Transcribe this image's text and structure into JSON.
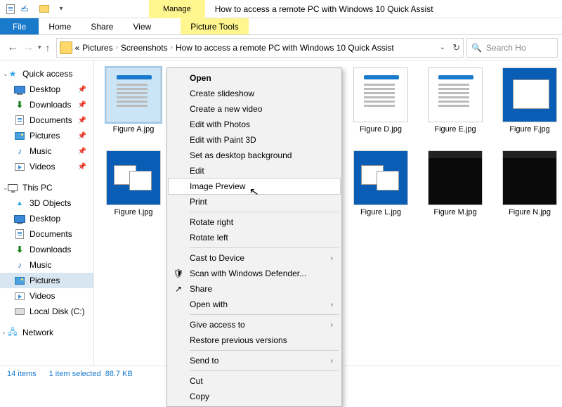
{
  "titlebar": {
    "manage_tab": "Manage",
    "tools_tab": "Picture Tools",
    "window_title": "How to access a remote PC with Windows 10 Quick Assist"
  },
  "ribbon": {
    "file": "File",
    "home": "Home",
    "share": "Share",
    "view": "View",
    "picture_tools": "Picture Tools"
  },
  "address": {
    "chevrons": "«",
    "crumbs": [
      "Pictures",
      "Screenshots",
      "How to access a remote PC with Windows 10 Quick Assist"
    ]
  },
  "search": {
    "placeholder": "Search Ho"
  },
  "sidebar": {
    "quick_access": "Quick access",
    "qa_items": [
      {
        "label": "Desktop",
        "icon": "desktop"
      },
      {
        "label": "Downloads",
        "icon": "downloads"
      },
      {
        "label": "Documents",
        "icon": "documents"
      },
      {
        "label": "Pictures",
        "icon": "pictures"
      },
      {
        "label": "Music",
        "icon": "music"
      },
      {
        "label": "Videos",
        "icon": "videos"
      }
    ],
    "this_pc": "This PC",
    "pc_items": [
      {
        "label": "3D Objects",
        "icon": "3d"
      },
      {
        "label": "Desktop",
        "icon": "desktop"
      },
      {
        "label": "Documents",
        "icon": "documents"
      },
      {
        "label": "Downloads",
        "icon": "downloads"
      },
      {
        "label": "Music",
        "icon": "music"
      },
      {
        "label": "Pictures",
        "icon": "pictures",
        "selected": true
      },
      {
        "label": "Videos",
        "icon": "videos"
      },
      {
        "label": "Local Disk (C:)",
        "icon": "disk"
      }
    ],
    "network": "Network"
  },
  "files_row1": [
    {
      "label": "Figure A.jpg",
      "thumb": "white",
      "selected": true
    },
    {
      "label": "Figure D.jpg",
      "thumb": "white"
    },
    {
      "label": "Figure E.jpg",
      "thumb": "white"
    },
    {
      "label": "Figure F.jpg",
      "thumb": "desk"
    }
  ],
  "files_row2": [
    {
      "label": "Figure I.jpg",
      "thumb": "desk2"
    },
    {
      "label": "Figure L.jpg",
      "thumb": "desk2"
    },
    {
      "label": "Figure M.jpg",
      "thumb": "black"
    },
    {
      "label": "Figure N.jpg",
      "thumb": "black"
    }
  ],
  "context_menu": [
    {
      "label": "Open",
      "bold": true
    },
    {
      "label": "Create slideshow"
    },
    {
      "label": "Create a new video"
    },
    {
      "label": "Edit with Photos"
    },
    {
      "label": "Edit with Paint 3D"
    },
    {
      "label": "Set as desktop background"
    },
    {
      "label": "Edit"
    },
    {
      "label": "Image Preview",
      "hover": true
    },
    {
      "label": "Print"
    },
    {
      "sep": true
    },
    {
      "label": "Rotate right"
    },
    {
      "label": "Rotate left"
    },
    {
      "sep": true
    },
    {
      "label": "Cast to Device",
      "submenu": true
    },
    {
      "label": "Scan with Windows Defender...",
      "icon": "shield"
    },
    {
      "label": "Share",
      "icon": "share"
    },
    {
      "label": "Open with",
      "submenu": true
    },
    {
      "sep": true
    },
    {
      "label": "Give access to",
      "submenu": true
    },
    {
      "label": "Restore previous versions"
    },
    {
      "sep": true
    },
    {
      "label": "Send to",
      "submenu": true
    },
    {
      "sep": true
    },
    {
      "label": "Cut"
    },
    {
      "label": "Copy"
    }
  ],
  "statusbar": {
    "count": "14 items",
    "selection": "1 item selected",
    "size": "88.7 KB"
  }
}
